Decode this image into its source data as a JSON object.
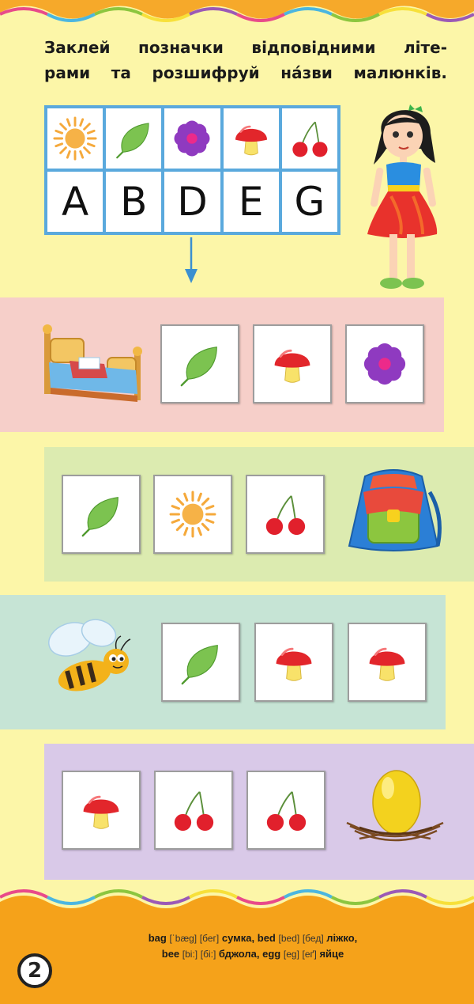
{
  "instruction": {
    "line1": "Заклей позначки відповідними літе-",
    "line2": "рами та розшифруй на́зви малюнків."
  },
  "key": {
    "icons": [
      "sun-icon",
      "leaf-icon",
      "flower-icon",
      "mushroom-icon",
      "cherry-icon"
    ],
    "letters": [
      "A",
      "B",
      "D",
      "E",
      "G"
    ]
  },
  "rows": [
    {
      "picture": "bed-picture",
      "band_color": "#f6cfc9",
      "tiles": [
        "leaf-icon",
        "mushroom-icon",
        "flower-icon"
      ]
    },
    {
      "picture": "bag-picture",
      "band_color": "#dcebb0",
      "tiles": [
        "leaf-icon",
        "sun-icon",
        "cherry-icon"
      ]
    },
    {
      "picture": "bee-picture",
      "band_color": "#c6e4d5",
      "tiles": [
        "leaf-icon",
        "mushroom-icon",
        "mushroom-icon"
      ]
    },
    {
      "picture": "egg-picture",
      "band_color": "#d9c9e8",
      "tiles": [
        "mushroom-icon",
        "cherry-icon",
        "cherry-icon"
      ]
    }
  ],
  "vocabulary": [
    {
      "word": "bag",
      "transcription": "[ˈbæg]",
      "reading": "[бег]",
      "translation": "сумка"
    },
    {
      "word": "bed",
      "transcription": "[bed]",
      "reading": "[бед]",
      "translation": "ліжко"
    },
    {
      "word": "bee",
      "transcription": "[bi:]",
      "reading": "[бі:]",
      "translation": "бджола"
    },
    {
      "word": "egg",
      "transcription": "[eg]",
      "reading": "[еґ]",
      "translation": "яйце"
    }
  ],
  "page_number": "2",
  "colors": {
    "accent_orange": "#f5a21a",
    "grid_blue": "#5aa9dd",
    "page_bg": "#fcf6a8"
  }
}
